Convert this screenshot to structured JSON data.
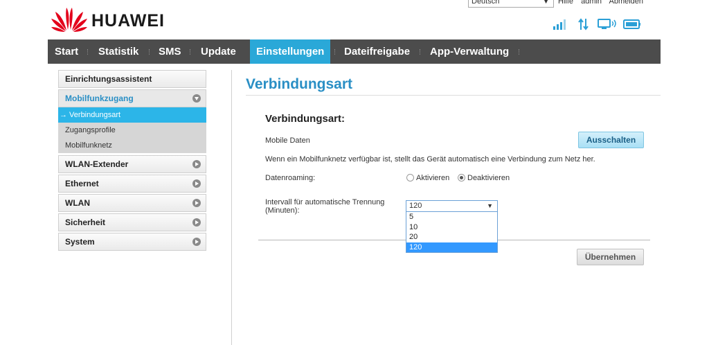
{
  "header": {
    "language": "Deutsch",
    "links": [
      "Hilfe",
      "admin",
      "Abmelden"
    ],
    "brand": "HUAWEI",
    "brand_color": "#e3001b"
  },
  "status": {
    "icons": [
      "signal-strength-icon",
      "data-transfer-icon",
      "monitor-wifi-icon",
      "battery-icon"
    ],
    "icon_color": "#2a9fd6"
  },
  "nav": {
    "items": [
      {
        "label": "Start"
      },
      {
        "label": "Statistik"
      },
      {
        "label": "SMS"
      },
      {
        "label": "Update"
      },
      {
        "label": "Einstellungen",
        "active": true
      },
      {
        "label": "Dateifreigabe"
      },
      {
        "label": "App-Verwaltung"
      }
    ],
    "active_color": "#2aa8d8",
    "bg_color": "#4c4c4c"
  },
  "sidebar": {
    "items": [
      {
        "label": "Einrichtungsassistent"
      },
      {
        "label": "Mobilfunkzugang",
        "open": true,
        "children": [
          {
            "label": "→ Verbindungsart",
            "active": true
          },
          {
            "label": "Zugangsprofile"
          },
          {
            "label": "Mobilfunknetz"
          }
        ]
      },
      {
        "label": "WLAN-Extender"
      },
      {
        "label": "Ethernet"
      },
      {
        "label": "WLAN"
      },
      {
        "label": "Sicherheit"
      },
      {
        "label": "System"
      }
    ]
  },
  "main": {
    "title": "Verbindungsart",
    "section_title": "Verbindungsart:",
    "mobile_data_label": "Mobile Daten",
    "mobile_data_button": "Ausschalten",
    "info_text": "Wenn ein Mobilfunknetz verfügbar ist, stellt das Gerät automatisch eine Verbindung zum Netz her.",
    "roaming_label": "Datenroaming:",
    "roaming_options": [
      "Aktivieren",
      "Deaktivieren"
    ],
    "roaming_selected": "Deaktivieren",
    "interval_label_line1": "Intervall für automatische Trennung",
    "interval_label_line2": "(Minuten):",
    "interval_value": "120",
    "interval_options": [
      "5",
      "10",
      "20",
      "120"
    ],
    "apply_button": "Übernehmen"
  }
}
